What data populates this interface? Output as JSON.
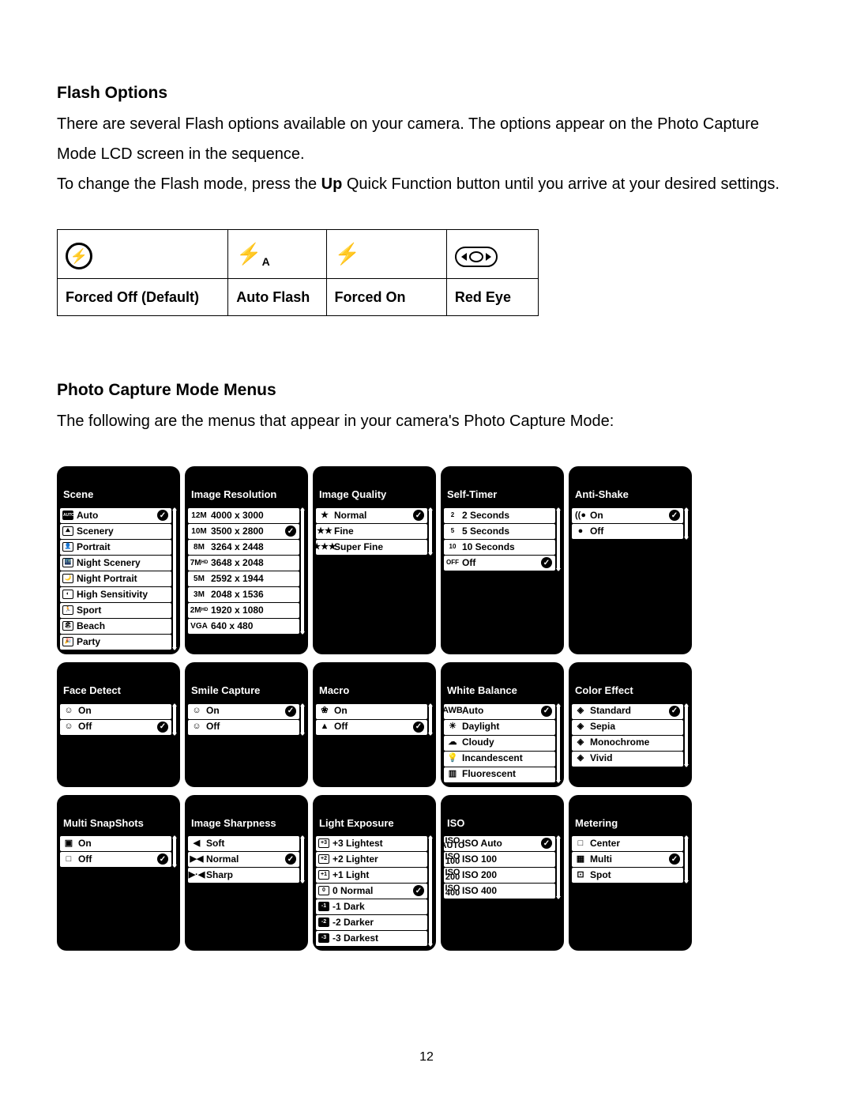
{
  "headings": {
    "flash_options": "Flash Options",
    "photo_menus": "Photo Capture Mode Menus"
  },
  "paragraphs": {
    "flash_intro1": "There are several Flash options available on your camera. The options appear on the Photo Capture Mode LCD screen in the sequence.",
    "flash_intro2_a": "To change the Flash mode, press the ",
    "flash_intro2_bold": "Up",
    "flash_intro2_b": " Quick Function button until you arrive at your desired settings.",
    "menus_intro": "The following are the menus that appear in your camera's Photo Capture Mode:"
  },
  "flash_table": {
    "col1": "Forced Off (Default)",
    "col2": "Auto Flash",
    "col3": "Forced On",
    "col4": "Red Eye"
  },
  "menus": {
    "scene": {
      "title": "Scene",
      "items": [
        {
          "label": "Auto",
          "selected": true,
          "icon": "AUTO"
        },
        {
          "label": "Scenery",
          "icon": "⛰"
        },
        {
          "label": "Portrait",
          "icon": "👤"
        },
        {
          "label": "Night Scenery",
          "icon": "🌃"
        },
        {
          "label": "Night Portrait",
          "icon": "🌙"
        },
        {
          "label": "High Sensitivity",
          "icon": "◐"
        },
        {
          "label": "Sport",
          "icon": "🏃"
        },
        {
          "label": "Beach",
          "icon": "🏖"
        },
        {
          "label": "Party",
          "icon": "🎉"
        }
      ]
    },
    "resolution": {
      "title": "Image Resolution",
      "items": [
        {
          "prefix": "12M",
          "label": "4000 x 3000"
        },
        {
          "prefix": "10M",
          "label": "3500 x 2800",
          "selected": true
        },
        {
          "prefix": "8M",
          "label": "3264 x 2448"
        },
        {
          "prefix": "7M HD",
          "label": "3648 x 2048"
        },
        {
          "prefix": "5M",
          "label": "2592 x 1944"
        },
        {
          "prefix": "3M",
          "label": "2048 x 1536"
        },
        {
          "prefix": "2M HD",
          "label": "1920 x 1080"
        },
        {
          "prefix": "VGA",
          "label": "640 x 480"
        }
      ]
    },
    "quality": {
      "title": "Image Quality",
      "items": [
        {
          "icon": "★",
          "label": "Normal",
          "selected": true
        },
        {
          "icon": "★★",
          "label": "Fine"
        },
        {
          "icon": "★★★",
          "label": "Super Fine"
        }
      ]
    },
    "selftimer": {
      "title": "Self-Timer",
      "items": [
        {
          "icon": "2",
          "label": "2 Seconds"
        },
        {
          "icon": "5",
          "label": "5 Seconds"
        },
        {
          "icon": "10",
          "label": "10 Seconds"
        },
        {
          "icon": "OFF",
          "label": "Off",
          "selected": true
        }
      ]
    },
    "antishake": {
      "title": "Anti-Shake",
      "items": [
        {
          "icon": "((●",
          "label": "On",
          "selected": true
        },
        {
          "icon": "●",
          "label": "Off"
        }
      ]
    },
    "facedetect": {
      "title": "Face Detect",
      "items": [
        {
          "icon": "☺",
          "label": "On"
        },
        {
          "icon": "☺",
          "label": "Off",
          "selected": true
        }
      ]
    },
    "smile": {
      "title": "Smile Capture",
      "items": [
        {
          "icon": "☺",
          "label": "On",
          "selected": true
        },
        {
          "icon": "☺",
          "label": "Off"
        }
      ]
    },
    "macro": {
      "title": "Macro",
      "items": [
        {
          "icon": "❀",
          "label": "On"
        },
        {
          "icon": "▲",
          "label": "Off",
          "selected": true
        }
      ]
    },
    "wb": {
      "title": "White Balance",
      "items": [
        {
          "icon": "AWB",
          "label": "Auto",
          "selected": true
        },
        {
          "icon": "☀",
          "label": "Daylight"
        },
        {
          "icon": "☁",
          "label": "Cloudy"
        },
        {
          "icon": "💡",
          "label": "Incandescent"
        },
        {
          "icon": "▥",
          "label": "Fluorescent"
        }
      ]
    },
    "coloreffect": {
      "title": "Color Effect",
      "items": [
        {
          "icon": "◈",
          "label": "Standard",
          "selected": true
        },
        {
          "icon": "◈",
          "label": "Sepia"
        },
        {
          "icon": "◈",
          "label": "Monochrome"
        },
        {
          "icon": "◈",
          "label": "Vivid"
        }
      ]
    },
    "multisnap": {
      "title": "Multi SnapShots",
      "items": [
        {
          "icon": "▣",
          "label": "On"
        },
        {
          "icon": "□",
          "label": "Off",
          "selected": true
        }
      ]
    },
    "sharpness": {
      "title": "Image Sharpness",
      "items": [
        {
          "icon": "◀",
          "label": "Soft"
        },
        {
          "icon": "▶◀",
          "label": "Normal",
          "selected": true
        },
        {
          "icon": "▶·◀",
          "label": "Sharp"
        }
      ]
    },
    "exposure": {
      "title": "Light Exposure",
      "items": [
        {
          "icon": "+3",
          "label": "+3 Lightest"
        },
        {
          "icon": "+2",
          "label": "+2 Lighter"
        },
        {
          "icon": "+1",
          "label": "+1 Light"
        },
        {
          "icon": "0",
          "label": "0 Normal",
          "selected": true
        },
        {
          "icon": "-1",
          "label": "-1 Dark"
        },
        {
          "icon": "-2",
          "label": "-2 Darker"
        },
        {
          "icon": "-3",
          "label": "-3 Darkest"
        }
      ]
    },
    "iso": {
      "title": "ISO",
      "items": [
        {
          "prefix": "ISO AUTO",
          "label": "ISO Auto",
          "selected": true
        },
        {
          "prefix": "ISO 100",
          "label": "ISO 100"
        },
        {
          "prefix": "ISO 200",
          "label": "ISO 200"
        },
        {
          "prefix": "ISO 400",
          "label": "ISO 400"
        }
      ]
    },
    "metering": {
      "title": "Metering",
      "items": [
        {
          "icon": "□",
          "label": "Center"
        },
        {
          "icon": "▦",
          "label": "Multi",
          "selected": true
        },
        {
          "icon": "⊡",
          "label": "Spot"
        }
      ]
    }
  },
  "page_number": "12"
}
